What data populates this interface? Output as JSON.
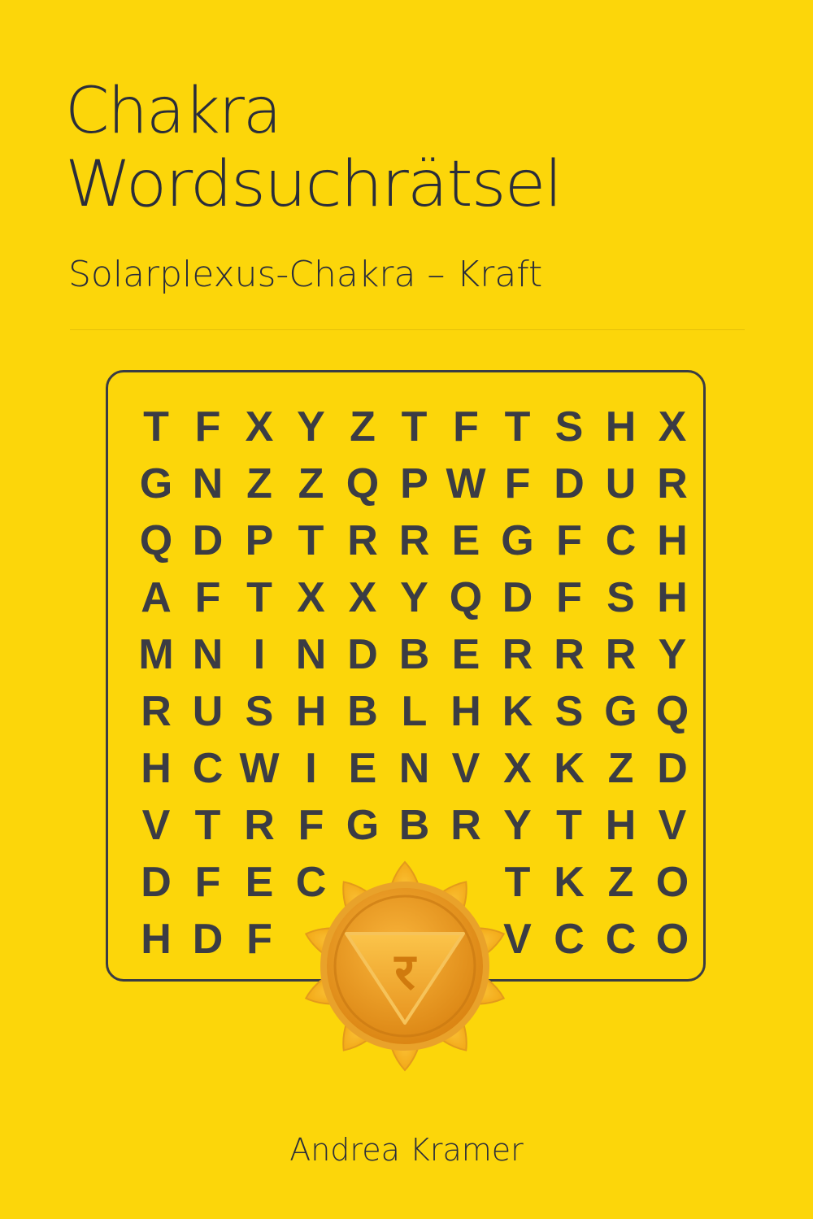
{
  "cover": {
    "title_line1": "Chakra",
    "title_line2": "Wordsuchrätsel",
    "subtitle": "Solarplexus-Chakra – Kraft",
    "author": "Andrea Kramer",
    "background_color": "#FCD60A",
    "text_color": "#2A2D3A"
  },
  "puzzle": {
    "rows": [
      [
        "T",
        "F",
        "X",
        "Y",
        "Z",
        "T",
        "F",
        "T",
        "S",
        "H",
        "X"
      ],
      [
        "G",
        "N",
        "Z",
        "Z",
        "Q",
        "P",
        "W",
        "F",
        "D",
        "U",
        "R"
      ],
      [
        "Q",
        "D",
        "P",
        "T",
        "R",
        "R",
        "E",
        "G",
        "F",
        "C",
        "H"
      ],
      [
        "A",
        "F",
        "T",
        "X",
        "X",
        "Y",
        "Q",
        "D",
        "F",
        "S",
        "H"
      ],
      [
        "M",
        "N",
        "I",
        "N",
        "D",
        "B",
        "E",
        "R",
        "R",
        "R",
        "Y"
      ],
      [
        "R",
        "U",
        "S",
        "H",
        "B",
        "L",
        "H",
        "K",
        "S",
        "G",
        "Q"
      ],
      [
        "H",
        "C",
        "W",
        "I",
        "E",
        "N",
        "V",
        "X",
        "K",
        "Z",
        "D"
      ],
      [
        "V",
        "T",
        "R",
        "F",
        "G",
        "B",
        "R",
        "Y",
        "T",
        "H",
        "V"
      ],
      [
        "D",
        "F",
        "E",
        "C",
        "",
        "",
        "",
        "T",
        "K",
        "Z",
        "O"
      ],
      [
        "H",
        "D",
        "F",
        "",
        "",
        "",
        "",
        "V",
        "C",
        "C",
        "O"
      ]
    ]
  },
  "emblem": {
    "icon": "solar-plexus-chakra-lotus-icon",
    "symbol": "र",
    "petal_color": "#F4A91A",
    "disc_color": "#E8901A"
  }
}
